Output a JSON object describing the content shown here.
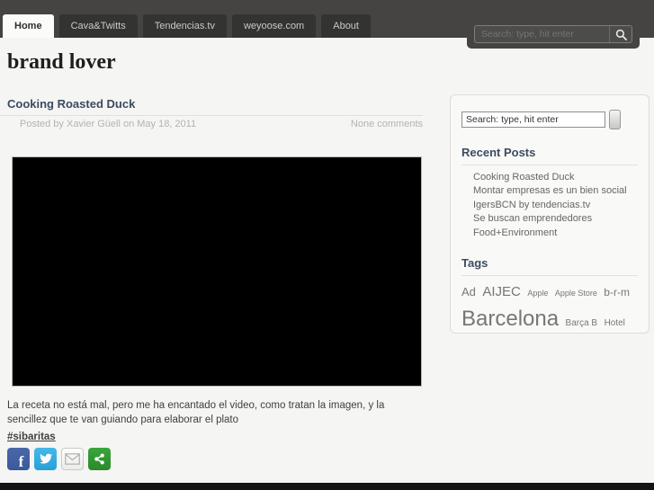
{
  "header": {
    "tabs": [
      {
        "label": "Home",
        "active": true
      },
      {
        "label": "Cava&Twitts",
        "active": false
      },
      {
        "label": "Tendencias.tv",
        "active": false
      },
      {
        "label": "weyoose.com",
        "active": false
      },
      {
        "label": "About",
        "active": false
      }
    ],
    "search": {
      "placeholder": "Search: type, hit enter"
    }
  },
  "site": {
    "title": "brand lover"
  },
  "post": {
    "title": "Cooking Roasted Duck",
    "byline": "Posted by Xavier Güell on May 18, 2011",
    "comments": "None comments",
    "body": "La receta no está mal, pero me ha encantado el video, como tratan la imagen, y la sencillez que te van guiando para elaborar el plato",
    "hashtag": "#sibaritas"
  },
  "sidebar": {
    "search_value": "Search: type, hit enter",
    "recent_posts_title": "Recent Posts",
    "recent_posts": [
      "Cooking Roasted Duck",
      "Montar empresas es un bien social",
      "IgersBCN by tendencias.tv",
      "Se buscan emprendedores",
      "Food+Environment"
    ],
    "tags_title": "Tags",
    "tags": [
      {
        "label": "Ad",
        "size": 13
      },
      {
        "label": "AIJEC",
        "size": 15
      },
      {
        "label": "Apple",
        "size": 9
      },
      {
        "label": "Apple Store",
        "size": 9
      },
      {
        "label": "b-r-m",
        "size": 12
      },
      {
        "label": "Barcelona",
        "size": 24
      },
      {
        "label": "Barça B",
        "size": 10
      },
      {
        "label": "Hotel",
        "size": 10
      }
    ]
  },
  "social": {
    "icons": [
      "facebook",
      "twitter",
      "email",
      "share"
    ]
  },
  "colors": {
    "header_bg": "#454442",
    "heading_accent": "#3c4b61",
    "facebook_blue": "#3a589b",
    "twitter_blue": "#29a0d8",
    "share_green": "#2f962f",
    "page_bg": "#f5f5f3"
  }
}
